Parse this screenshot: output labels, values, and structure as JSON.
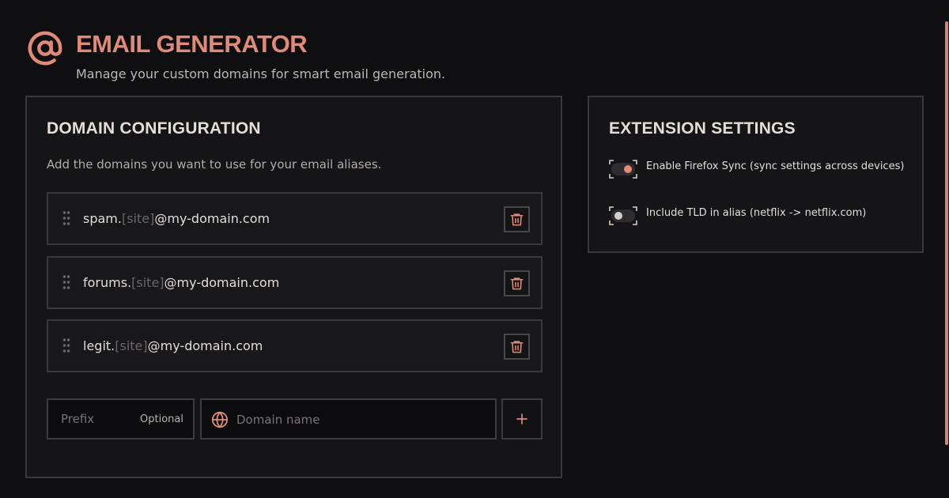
{
  "header": {
    "icon": "at-sign-icon",
    "title": "EMAIL GENERATOR",
    "subtitle": "Manage your custom domains for smart email generation."
  },
  "domain_config": {
    "title": "DOMAIN CONFIGURATION",
    "description": "Add the domains you want to use for your email aliases.",
    "domains": [
      {
        "prefix": "spam.",
        "site_token": "[site]",
        "domain": "@my-domain.com"
      },
      {
        "prefix": "forums.",
        "site_token": "[site]",
        "domain": "@my-domain.com"
      },
      {
        "prefix": "legit.",
        "site_token": "[site]",
        "domain": "@my-domain.com"
      }
    ],
    "new_domain": {
      "prefix_placeholder": "Prefix",
      "optional_label": "Optional",
      "domain_placeholder": "Domain name",
      "add_label": "+"
    }
  },
  "extension_settings": {
    "title": "EXTENSION SETTINGS",
    "settings": [
      {
        "label": "Enable Firefox Sync (sync settings across devices)",
        "enabled": true
      },
      {
        "label": "Include TLD in alias (netflix -> netflix.com)",
        "enabled": false
      }
    ]
  },
  "colors": {
    "accent": "#e08a78",
    "background": "#0f0e10",
    "panel": "#151416",
    "border": "#3a383a",
    "toggle_on_knob": "#e08a78",
    "toggle_off_knob": "#d6d0cc"
  }
}
